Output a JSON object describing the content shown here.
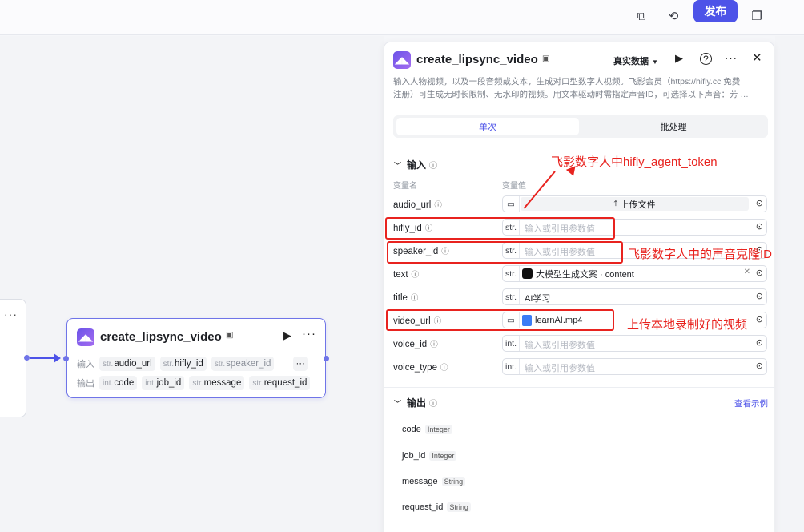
{
  "topbar": {
    "publish_label": "发布",
    "icons": [
      "copy-icon",
      "history-icon",
      "duplicate-icon"
    ]
  },
  "canvas": {
    "left_node": {
      "more": "···"
    },
    "node": {
      "title": "create_lipsync_video",
      "run_icon": "▶",
      "more": "···",
      "input_label": "输入",
      "output_label": "输出",
      "inputs": [
        {
          "type": "str.",
          "name": "audio_url"
        },
        {
          "type": "str.",
          "name": "hifly_id"
        },
        {
          "type": "str.",
          "name": "speaker_id"
        }
      ],
      "inputs_more": "···",
      "outputs": [
        {
          "type": "int.",
          "name": "code"
        },
        {
          "type": "int.",
          "name": "job_id"
        },
        {
          "type": "str.",
          "name": "message"
        },
        {
          "type": "str.",
          "name": "request_id"
        }
      ]
    }
  },
  "panel": {
    "title": "create_lipsync_video",
    "data_mode": "真实数据",
    "description_line1": "输入人物视频，以及一段音频或文本，生成对口型数字人视频。飞影会员（https://hifly.cc 免费",
    "description_line2": "注册）可生成无时长限制、无水印的视频。用文本驱动时需指定声音ID，可选择以下声音：芳 …",
    "tabs": {
      "single": "单次",
      "batch": "批处理"
    },
    "input_section": "输入",
    "col_name": "变量名",
    "col_value": "变量值",
    "params": [
      {
        "name": "audio_url",
        "type": "",
        "value": "上传文件"
      },
      {
        "name": "hifly_id",
        "type": "str.",
        "value": "输入或引用参数值"
      },
      {
        "name": "speaker_id",
        "type": "str.",
        "value": "输入或引用参数值"
      },
      {
        "name": "text",
        "type": "str.",
        "value": "大模型生成文案 · content"
      },
      {
        "name": "title",
        "type": "str.",
        "value": "AI学习"
      },
      {
        "name": "video_url",
        "type": "",
        "value": "learnAI.mp4"
      },
      {
        "name": "voice_id",
        "type": "int.",
        "value": "输入或引用参数值"
      },
      {
        "name": "voice_type",
        "type": "int.",
        "value": "输入或引用参数值"
      }
    ],
    "output_section": "输出",
    "view_example": "查看示例",
    "outputs": [
      {
        "name": "code",
        "type": "Integer"
      },
      {
        "name": "job_id",
        "type": "Integer"
      },
      {
        "name": "message",
        "type": "String"
      },
      {
        "name": "request_id",
        "type": "String"
      }
    ]
  },
  "annotations": {
    "token_note": "飞影数字人中hifly_agent_token",
    "voice_note": "飞影数字人中的声音克隆ID",
    "video_note": "上传本地录制好的视频",
    "color": "#e8231f"
  },
  "colors": {
    "accent": "#4d53e8",
    "annotation": "#e8231f"
  }
}
